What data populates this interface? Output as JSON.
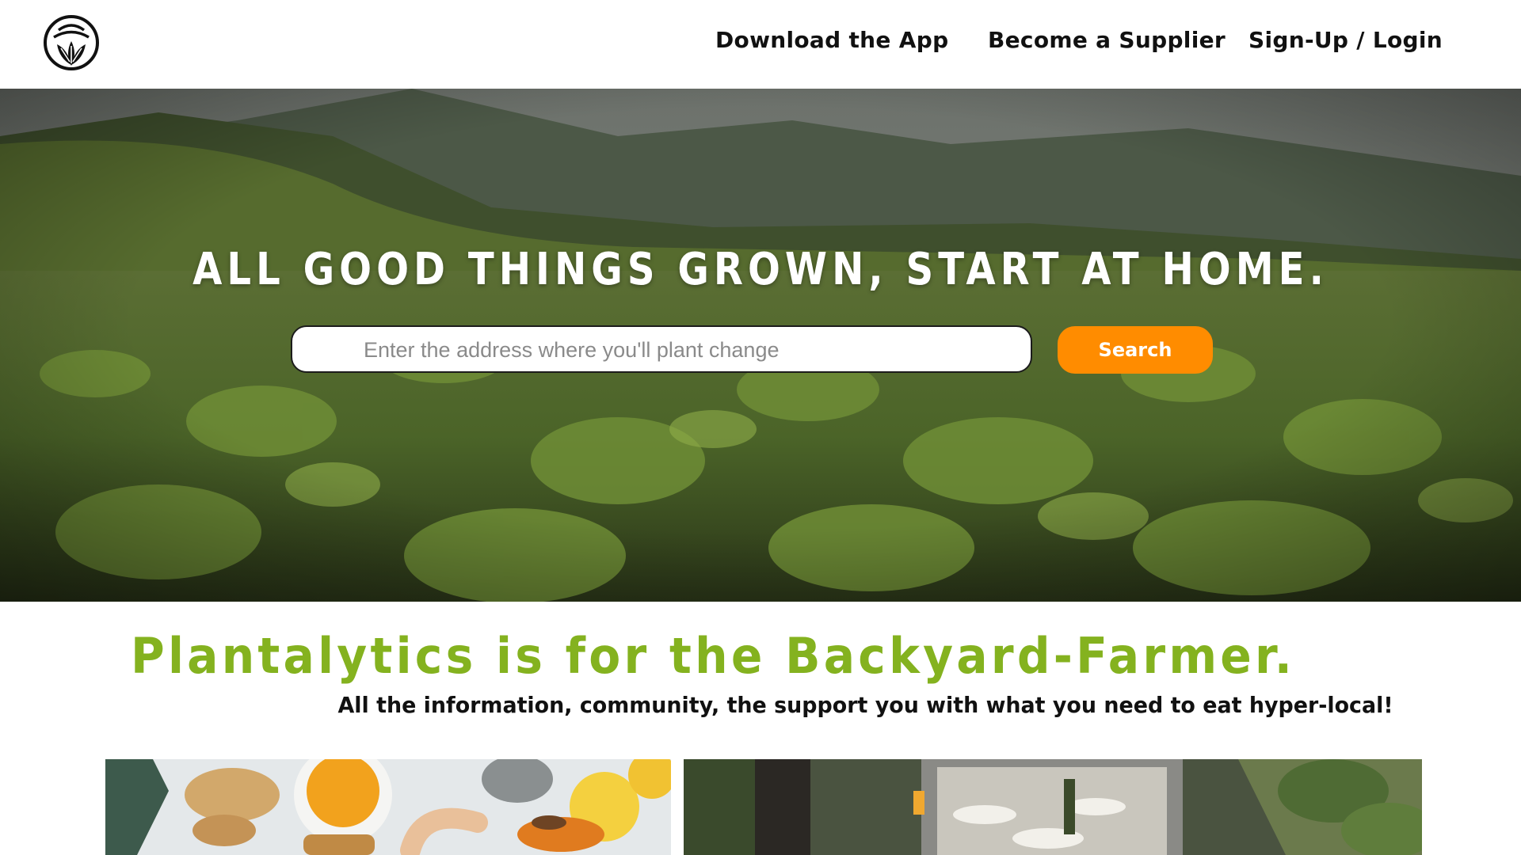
{
  "nav": {
    "download_app": "Download the App",
    "become_supplier": "Become a Supplier",
    "signup_login": "Sign-Up / Login",
    "logo_icon": "leaf-logo-icon"
  },
  "hero": {
    "title": "ALL GOOD THINGS GROWN, START AT HOME.",
    "search_placeholder": "Enter the address where you'll plant change",
    "search_value": "",
    "search_button": "Search"
  },
  "colors": {
    "accent_orange": "#ff8c00",
    "brand_green": "#84b21f",
    "text_dark": "#111111"
  },
  "intro": {
    "title": "Plantalytics is for the Backyard-Farmer.",
    "subtitle": "All the information, community, the support you with what you need to eat hyper-local!"
  }
}
